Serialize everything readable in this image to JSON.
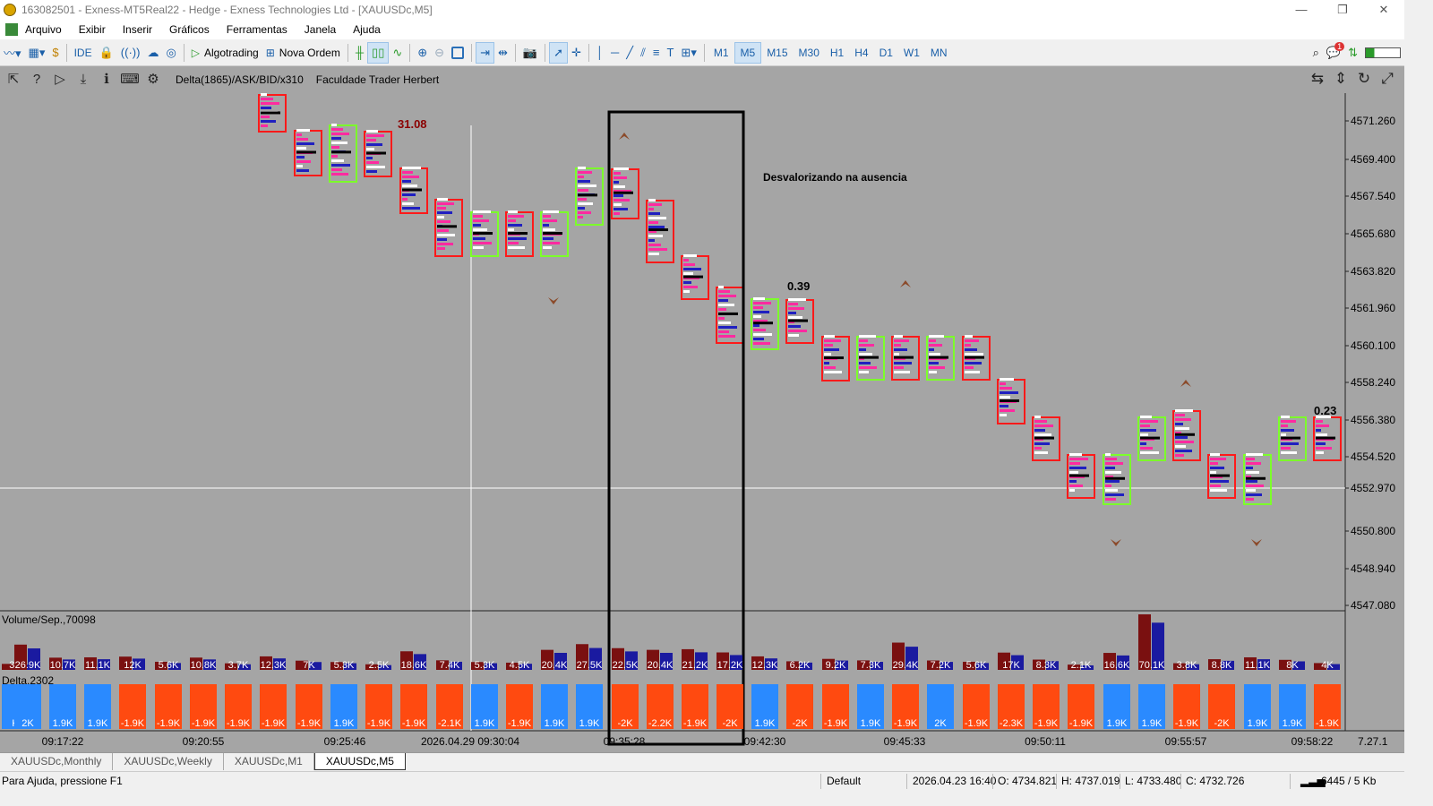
{
  "window": {
    "title": "163082501 - Exness-MT5Real22 - Hedge - Exness Technologies Ltd - [XAUUSDc,M5]",
    "controls": [
      "—",
      "❐",
      "✕"
    ]
  },
  "menu": [
    "Arquivo",
    "Exibir",
    "Inserir",
    "Gráficos",
    "Ferramentas",
    "Janela",
    "Ajuda"
  ],
  "toolbar": {
    "ide_label": "IDE",
    "algotrading_label": "Algotrading",
    "nova_ordem_label": "Nova Ordem",
    "timeframes": [
      "M1",
      "M5",
      "M15",
      "M30",
      "H1",
      "H4",
      "D1",
      "W1",
      "MN"
    ],
    "active_timeframe": "M5",
    "notification_count": "1"
  },
  "chart": {
    "indicator_label": "Delta(1865)/ASK/BID/x310",
    "author_label": "Faculdade Trader Herbert",
    "annotation": "Desvalorizando na ausencia",
    "labels": {
      "a": "31.08",
      "b": "0.39",
      "c": "0.23"
    },
    "volume_label": "Volume/Sep.,70098",
    "delta_label": "Delta,2302",
    "price_ticks": [
      "4571.260",
      "4569.400",
      "4567.540",
      "4565.680",
      "4563.820",
      "4561.960",
      "4560.100",
      "4558.240",
      "4556.380",
      "4554.520",
      "4552.970",
      "4550.800",
      "4548.940",
      "4547.080"
    ],
    "time_ticks": [
      "09:17:22",
      "09:20:55",
      "09:25:46",
      "2026.04.29 09:30:04",
      "09:35:28",
      "09:42:30",
      "09:45:33",
      "09:50:11",
      "09:55:57",
      "09:58:22"
    ],
    "corner_value": "7.27.1",
    "volume_values": [
      "3K",
      "26.9K",
      "10.7K",
      "11.1K",
      "12K",
      "5.6K",
      "10.8K",
      "3.7K",
      "12.3K",
      "7K",
      "5.3K",
      "2.5K",
      "18.6K",
      "7.4K",
      "5.3K",
      "4.5K",
      "20.4K",
      "27.5K",
      "22.5K",
      "20.4K",
      "21.2K",
      "17.2K",
      "12.3K",
      "6.2K",
      "9.2K",
      "7.3K",
      "29.4K",
      "7.2K",
      "5.6K",
      "17K",
      "8.3K",
      "2.1K",
      "16.6K",
      "70.1K",
      "3.8K",
      "8.8K",
      "11.1K",
      "8K",
      "4K"
    ],
    "delta_values": [
      "K",
      "2K",
      "1.9K",
      "1.9K",
      "-1.9K",
      "-1.9K",
      "-1.9K",
      "-1.9K",
      "-1.9K",
      "-1.9K",
      "1.9K",
      "-1.9K",
      "-1.9K",
      "-2.1K",
      "1.9K",
      "-1.9K",
      "1.9K",
      "1.9K",
      "-2K",
      "-2.2K",
      "-1.9K",
      "-2K",
      "1.9K",
      "-2K",
      "-1.9K",
      "1.9K",
      "-1.9K",
      "2K",
      "-1.9K",
      "-2.3K",
      "-1.9K",
      "-1.9K",
      "1.9K",
      "1.9K",
      "-1.9K",
      "-2K",
      "1.9K",
      "1.9K",
      "-1.9K"
    ]
  },
  "tabs": [
    "XAUUSDc,Monthly",
    "XAUUSDc,Weekly",
    "XAUUSDc,M1",
    "XAUUSDc,M5"
  ],
  "active_tab": "XAUUSDc,M5",
  "status": {
    "help": "Para Ajuda, pressione F1",
    "profile": "Default",
    "datetime": "2026.04.23 16:40",
    "open": "O: 4734.821",
    "high": "H: 4737.019",
    "low": "L: 4733.480",
    "close": "C: 4732.726",
    "traffic": "6445 / 5 Kb"
  }
}
